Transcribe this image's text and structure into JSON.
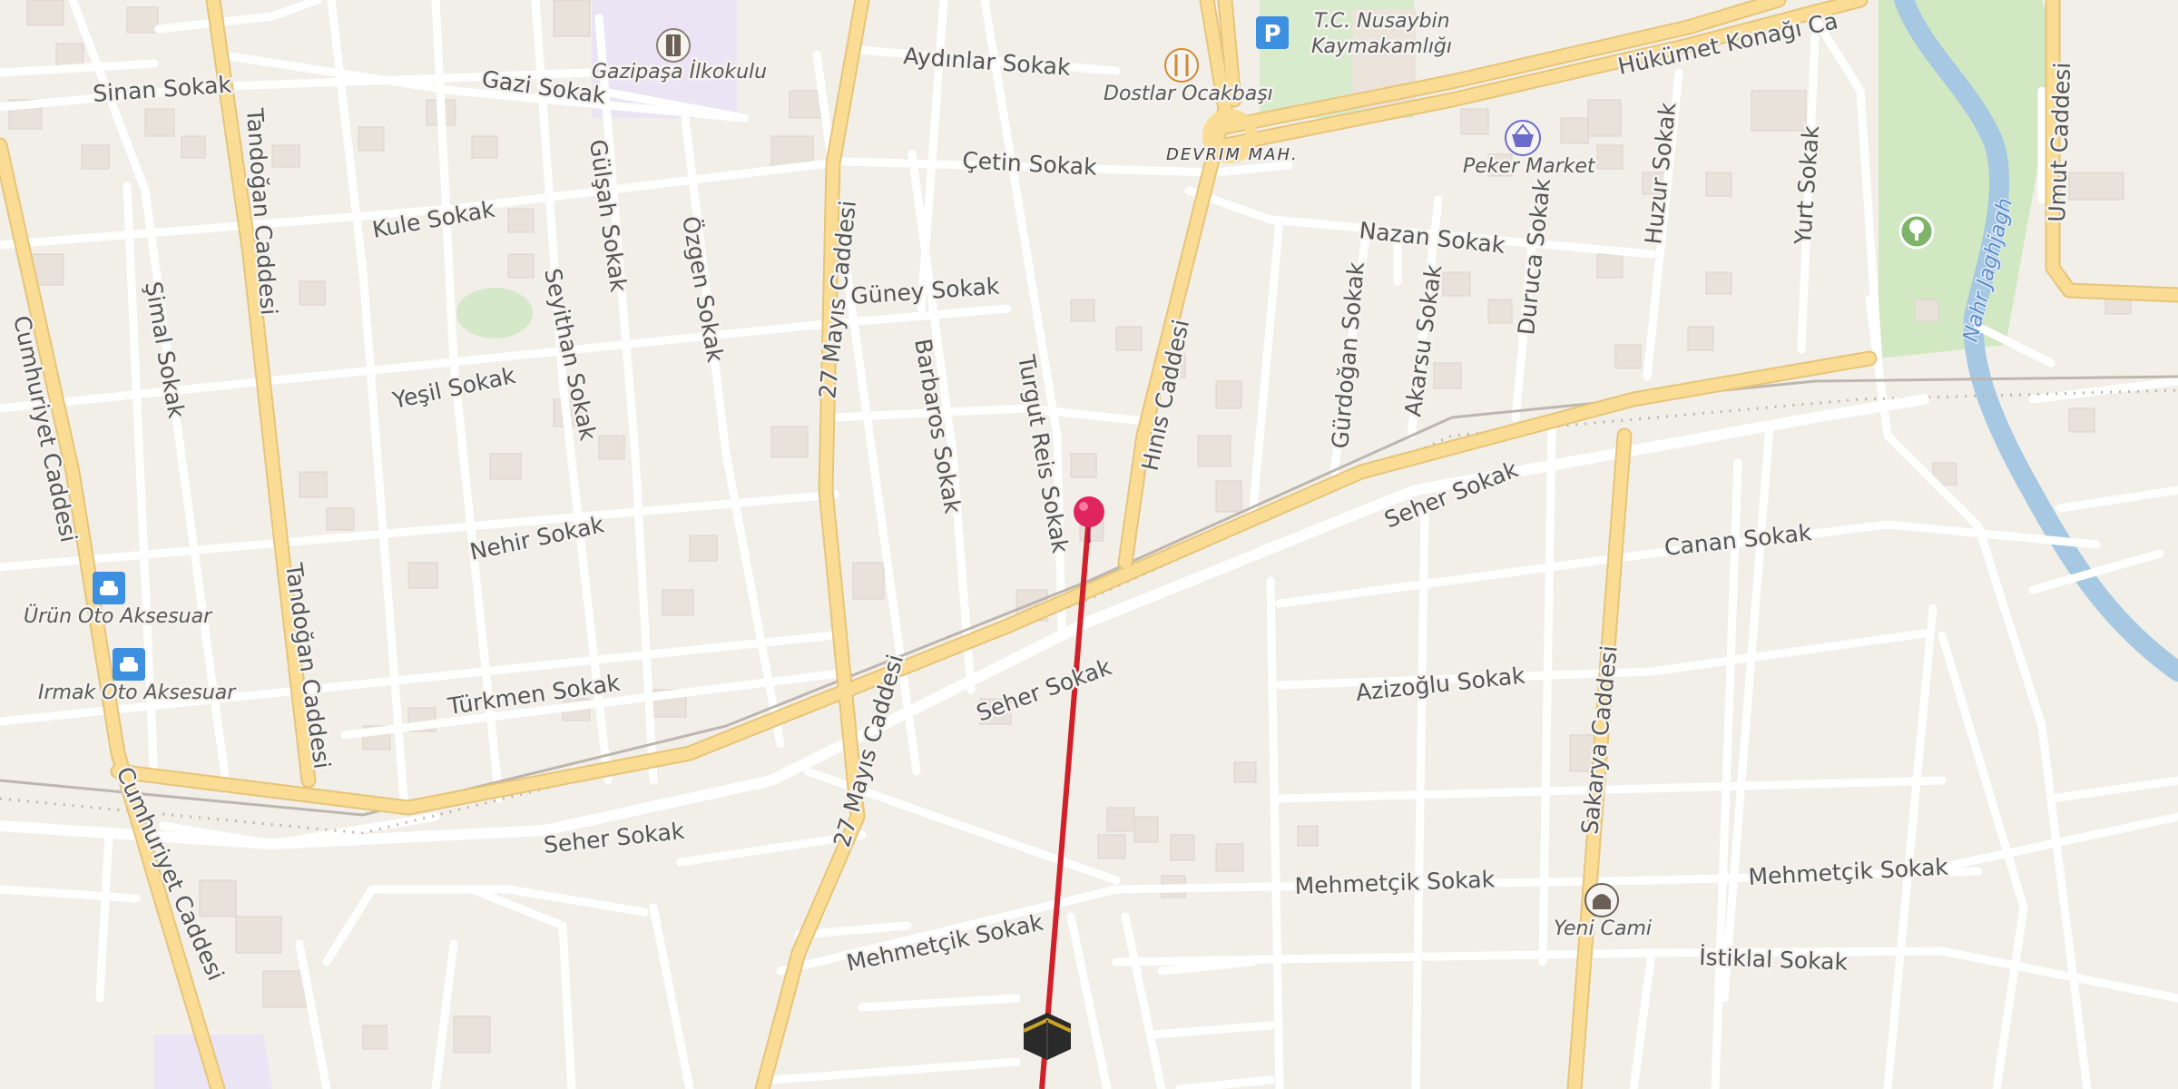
{
  "map": {
    "district": "DEVRIM MAH.",
    "river": "Nahr Jaghjagh",
    "streets": {
      "sinan": "Sinan Sokak",
      "gazi": "Gazi Sokak",
      "aydinlar": "Aydınlar Sokak",
      "cetin": "Çetin Sokak",
      "kule": "Kule Sokak",
      "gulsah": "Gülşah Sokak",
      "ozgen": "Özgen Sokak",
      "seyithan": "Seyithan Sokak",
      "simal": "Şimal Sokak",
      "tandogan": "Tandoğan Caddesi",
      "cumhuriyet": "Cumhuriyet Caddesi",
      "mayis27": "27 Mayıs Caddesi",
      "guney": "Güney Sokak",
      "barbaros": "Barbaros Sokak",
      "turgutreis": "Turgut Reis Sokak",
      "hinis": "Hınıs Caddesi",
      "yesil": "Yeşil Sokak",
      "nehir": "Nehir Sokak",
      "turkmen": "Türkmen Sokak",
      "seher": "Seher Sokak",
      "nazan": "Nazan Sokak",
      "gurdogan": "Gürdoğan Sokak",
      "akarsu": "Akarsu Sokak",
      "duruca": "Duruca Sokak",
      "huzur": "Huzur Sokak",
      "yurt": "Yurt Sokak",
      "umut": "Umut Caddesi",
      "hukumet": "Hükümet Konağı Ca",
      "canan": "Canan Sokak",
      "azizoglu": "Azizoğlu Sokak",
      "sakarya": "Sakarya Caddesi",
      "mehmetcik": "Mehmetçik Sokak",
      "istiklal": "İstiklal Sokak"
    },
    "pois": [
      {
        "name": "Gazipaşa İlkokulu",
        "icon": "school-icon"
      },
      {
        "name": "Dostlar Ocakbaşı",
        "icon": "restaurant-icon"
      },
      {
        "name": "T.C. Nusaybin",
        "name2": "Kaymakamlığı",
        "icon": "parking-icon"
      },
      {
        "name": "Peker Market",
        "icon": "shopping-basket-icon"
      },
      {
        "name": "Ürün Oto Aksesuar",
        "icon": "car-icon"
      },
      {
        "name": "Irmak Oto Aksesuar",
        "icon": "car-icon"
      },
      {
        "name": "Yeni Cami",
        "icon": "mosque-icon"
      }
    ],
    "colors": {
      "background": "#f2efe9",
      "major_road": "#fbdc94",
      "minor_road": "#ffffff",
      "qibla_line": "#d0202a",
      "pin": "#e0245e",
      "water": "#a6c8e3",
      "park": "#cfe8bf",
      "poi_blue": "#3d8fe0"
    },
    "markers": {
      "location_pin": "location-pin-icon",
      "kaaba": "kaaba-icon"
    }
  }
}
